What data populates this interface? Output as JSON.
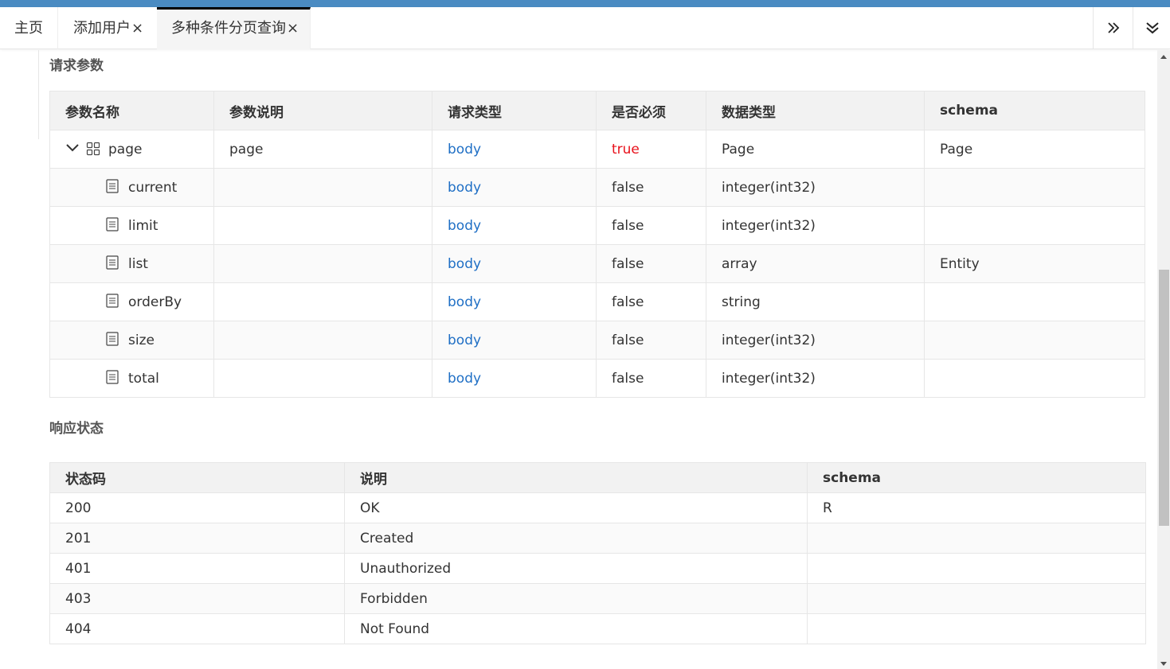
{
  "tabs": [
    {
      "label": "主页",
      "closable": false
    },
    {
      "label": "添加用户",
      "closable": true
    },
    {
      "label": "多种条件分页查询",
      "closable": true,
      "active": true
    }
  ],
  "close_glyph": "×",
  "request_section": {
    "title": "请求参数",
    "headers": [
      "参数名称",
      "参数说明",
      "请求类型",
      "是否必须",
      "数据类型",
      "schema"
    ],
    "rows": [
      {
        "name": "page",
        "desc": "page",
        "in": "body",
        "required": "true",
        "type": "Page",
        "schema": "Page",
        "root": true
      },
      {
        "name": "current",
        "desc": "",
        "in": "body",
        "required": "false",
        "type": "integer(int32)",
        "schema": ""
      },
      {
        "name": "limit",
        "desc": "",
        "in": "body",
        "required": "false",
        "type": "integer(int32)",
        "schema": ""
      },
      {
        "name": "list",
        "desc": "",
        "in": "body",
        "required": "false",
        "type": "array",
        "schema": "Entity"
      },
      {
        "name": "orderBy",
        "desc": "",
        "in": "body",
        "required": "false",
        "type": "string",
        "schema": ""
      },
      {
        "name": "size",
        "desc": "",
        "in": "body",
        "required": "false",
        "type": "integer(int32)",
        "schema": ""
      },
      {
        "name": "total",
        "desc": "",
        "in": "body",
        "required": "false",
        "type": "integer(int32)",
        "schema": ""
      }
    ]
  },
  "response_section": {
    "title": "响应状态",
    "headers": [
      "状态码",
      "说明",
      "schema"
    ],
    "rows": [
      {
        "code": "200",
        "desc": "OK",
        "schema": "R"
      },
      {
        "code": "201",
        "desc": "Created",
        "schema": ""
      },
      {
        "code": "401",
        "desc": "Unauthorized",
        "schema": ""
      },
      {
        "code": "403",
        "desc": "Forbidden",
        "schema": ""
      },
      {
        "code": "404",
        "desc": "Not Found",
        "schema": ""
      }
    ]
  },
  "colors": {
    "accent_bar": "#4a8bc2",
    "link_blue": "#1f6fc5",
    "required_red": "#e8111b"
  },
  "icons": {
    "tab_scroll": "double-chevron-right-icon",
    "tab_menu": "double-chevron-down-icon",
    "expand": "chevron-down-icon",
    "object": "grid-icon",
    "field": "document-icon"
  }
}
